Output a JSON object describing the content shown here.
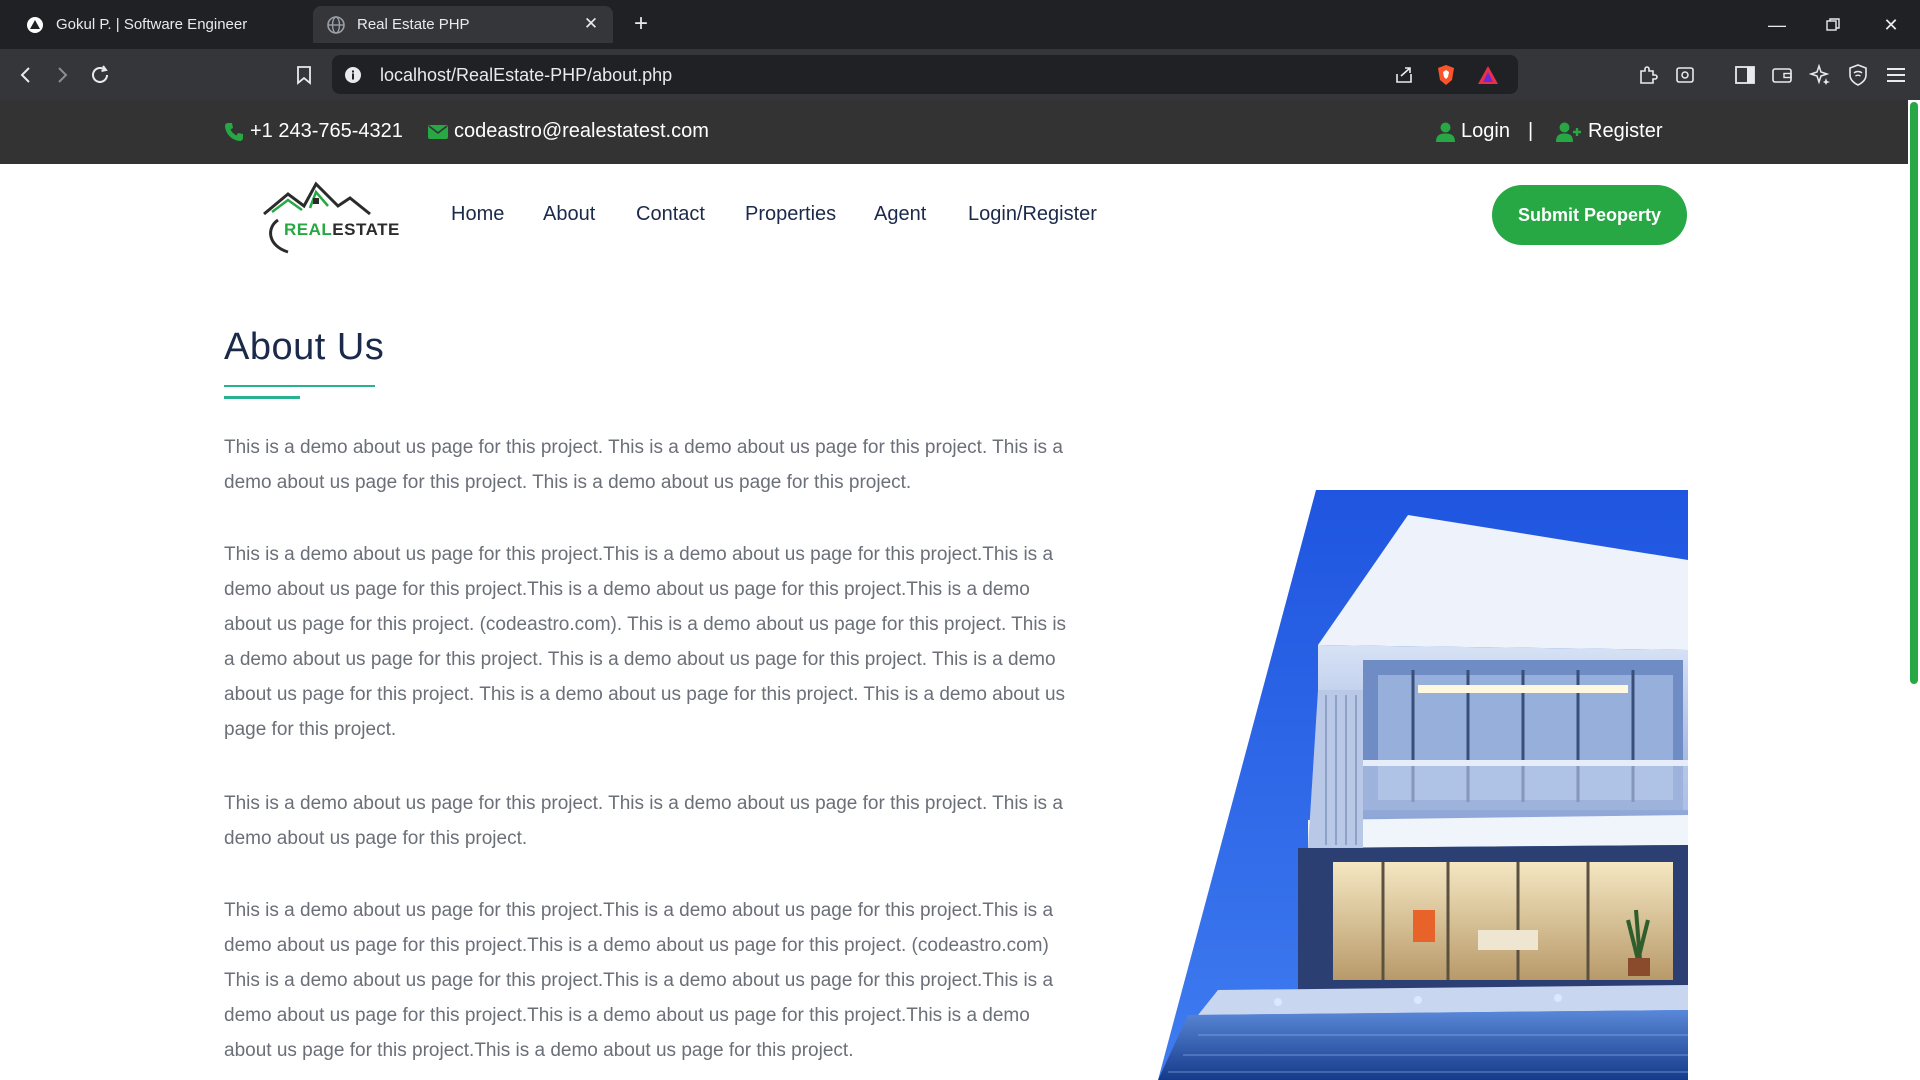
{
  "browser": {
    "tabs": [
      {
        "title": "Gokul P. | Software Engineer",
        "active": false
      },
      {
        "title": "Real Estate PHP",
        "active": true
      }
    ],
    "url": "localhost/RealEstate-PHP/about.php"
  },
  "topbar": {
    "phone": "+1 243-765-4321",
    "email": "codeastro@realestatest.com",
    "login": "Login",
    "separator": "|",
    "register": "Register"
  },
  "logo": {
    "text_part1": "REAL",
    "text_part2": "ESTATE"
  },
  "nav": {
    "items": [
      "Home",
      "About",
      "Contact",
      "Properties",
      "Agent",
      "Login/Register"
    ],
    "submit_label": "Submit Peoperty"
  },
  "about": {
    "title": "About Us",
    "paragraphs": [
      "This is a demo about us page for this project. This is a demo about us page for this project. This is a demo about us page for this project. This is a demo about us page for this project.",
      "This is a demo about us page for this project.This is a demo about us page for this project.This is a demo about us page for this project.This is a demo about us page for this project.This is a demo about us page for this project. (codeastro.com). This is a demo about us page for this project. This is a demo about us page for this project. This is a demo about us page for this project. This is a demo about us page for this project. This is a demo about us page for this project. This is a demo about us page for this project.",
      "This is a demo about us page for this project. This is a demo about us page for this project. This is a demo about us page for this project.",
      "This is a demo about us page for this project.This is a demo about us page for this project.This is a demo about us page for this project.This is a demo about us page for this project. (codeastro.com) This is a demo about us page for this project.This is a demo about us page for this project.This is a demo about us page for this project.This is a demo about us page for this project.This is a demo about us page for this project.This is a demo about us page for this project."
    ]
  },
  "colors": {
    "accent_green": "#28a745",
    "underline_teal": "#28b28e",
    "topbar_bg": "#333333",
    "heading_navy": "#1b2a4a",
    "body_text": "#6b6f78"
  }
}
